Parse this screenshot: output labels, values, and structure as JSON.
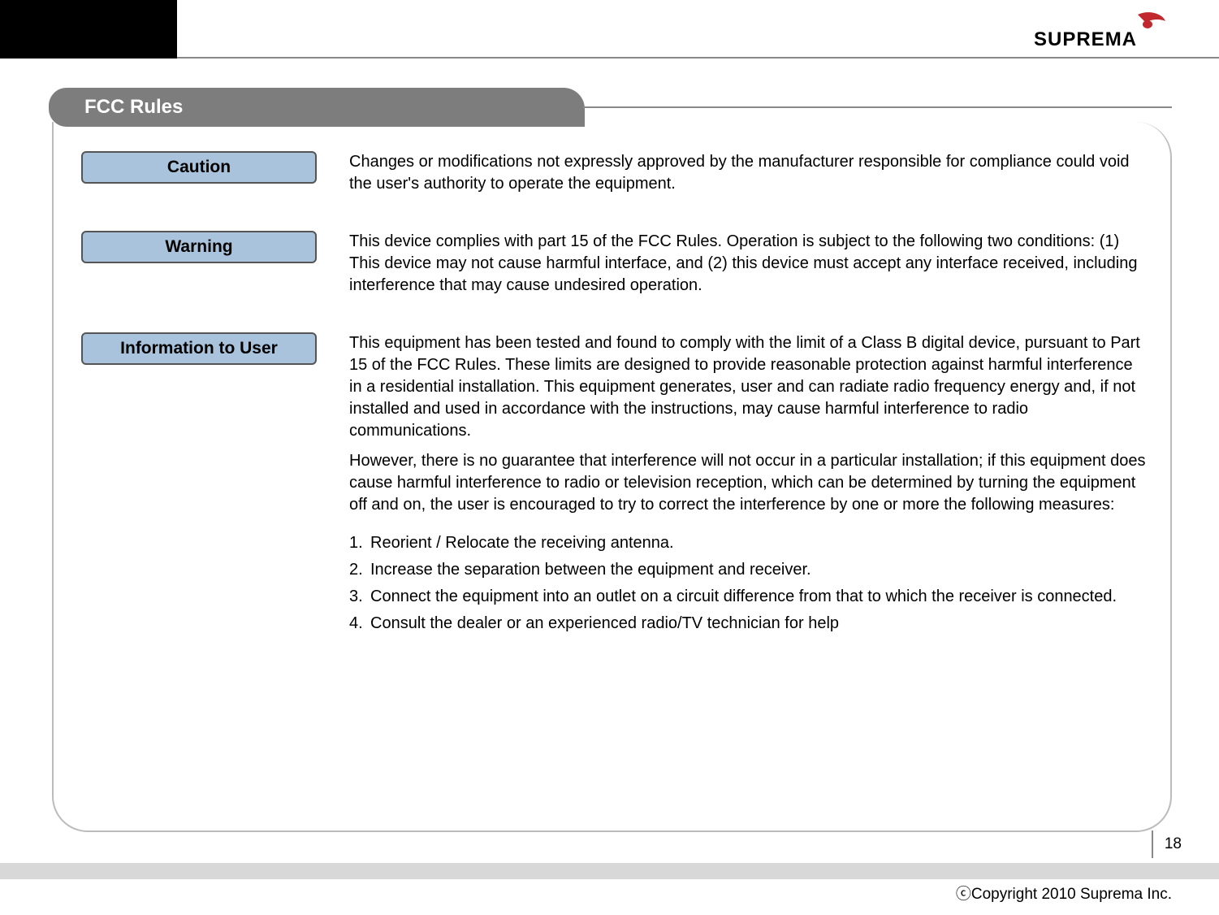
{
  "brand": "SUPREMA",
  "title": "FCC Rules",
  "sections": {
    "caution": {
      "label": "Caution",
      "text": "Changes or modifications not expressly approved by the manufacturer responsible for compliance could void the user's authority to operate the equipment."
    },
    "warning": {
      "label": "Warning",
      "text": "This device complies with part 15 of the FCC Rules. Operation is subject to the following two conditions: (1) This device may not cause harmful interface, and (2) this device must accept any interface received, including interference that may cause undesired operation."
    },
    "info": {
      "label": "Information to User",
      "p1": "This equipment has been tested and found to comply with the limit of a Class B digital device, pursuant to Part 15 of the FCC Rules. These limits are designed to provide reasonable protection against harmful interference in a residential installation. This equipment generates, user and can  radiate radio frequency energy and, if not installed and used in accordance with the instructions, may cause harmful interference to radio communications.",
      "p2": "However, there is no guarantee that interference will not occur in a particular installation; if this equipment does cause harmful interference to radio or television reception, which can be determined by turning the equipment off and on, the user is encouraged to try to correct the interference by one or more the following measures:",
      "measures": [
        "Reorient / Relocate the receiving antenna.",
        "Increase the separation between the equipment and receiver.",
        "Connect the equipment into an outlet on a circuit difference from that to which the receiver is connected.",
        "Consult the dealer or an experienced radio/TV technician for help"
      ]
    }
  },
  "page_number": "18",
  "copyright": "ⓒCopyright 2010 Suprema Inc."
}
